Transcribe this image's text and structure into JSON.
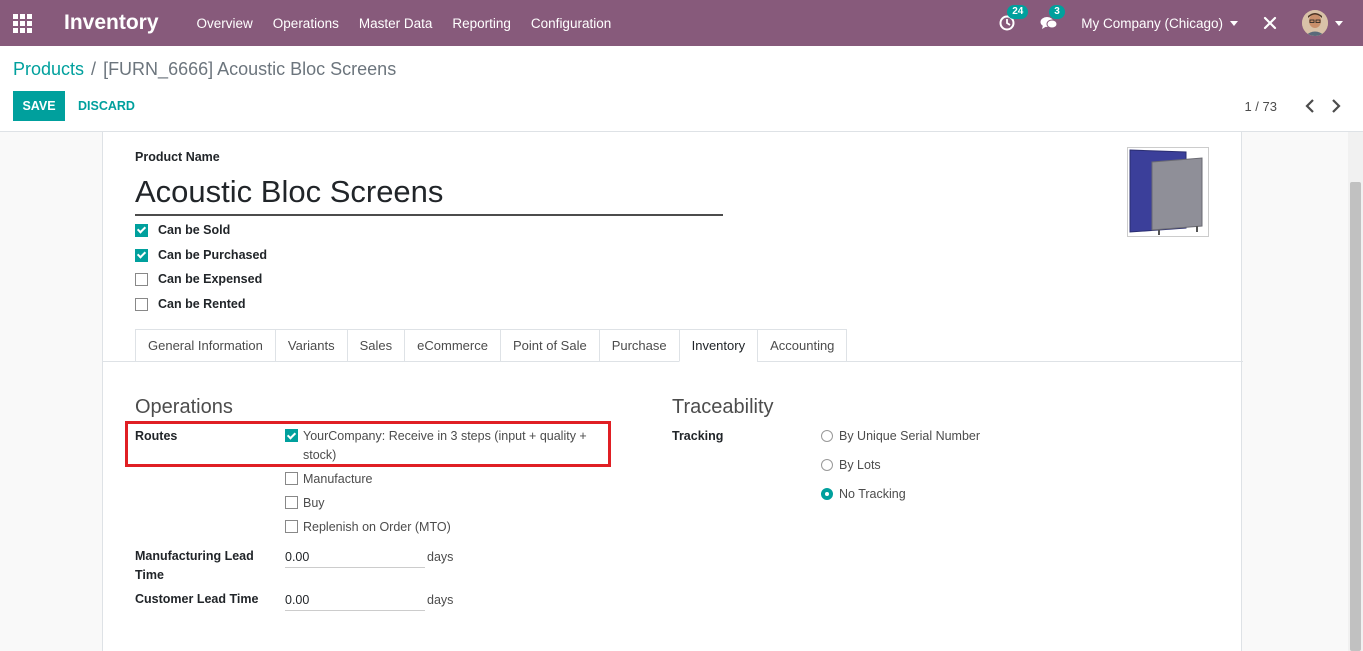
{
  "navbar": {
    "brand": "Inventory",
    "menu": [
      "Overview",
      "Operations",
      "Master Data",
      "Reporting",
      "Configuration"
    ],
    "activity_badge": "24",
    "messages_badge": "3",
    "company": "My Company (Chicago)"
  },
  "control_panel": {
    "breadcrumb_parent": "Products",
    "breadcrumb_current": "[FURN_6666] Acoustic Bloc Screens",
    "save_label": "SAVE",
    "discard_label": "DISCARD",
    "pager": "1 / 73"
  },
  "product": {
    "name_label": "Product Name",
    "name": "Acoustic Bloc Screens",
    "flags": [
      {
        "label": "Can be Sold",
        "checked": true
      },
      {
        "label": "Can be Purchased",
        "checked": true
      },
      {
        "label": "Can be Expensed",
        "checked": false
      },
      {
        "label": "Can be Rented",
        "checked": false
      }
    ]
  },
  "tabs": [
    "General Information",
    "Variants",
    "Sales",
    "eCommerce",
    "Point of Sale",
    "Purchase",
    "Inventory",
    "Accounting"
  ],
  "active_tab": "Inventory",
  "operations": {
    "title": "Operations",
    "routes_label": "Routes",
    "routes": [
      {
        "label_line1": "YourCompany: Receive in 3 steps (input + quality +",
        "label_line2": "stock)",
        "checked": true
      },
      {
        "label": "Manufacture",
        "checked": false
      },
      {
        "label": "Buy",
        "checked": false
      },
      {
        "label": "Replenish on Order (MTO)",
        "checked": false
      }
    ],
    "mfg_lead_label_line1": "Manufacturing Lead",
    "mfg_lead_label_line2": "Time",
    "mfg_lead_value": "0.00",
    "customer_lead_label": "Customer Lead Time",
    "customer_lead_value": "0.00",
    "unit": "days"
  },
  "traceability": {
    "title": "Traceability",
    "tracking_label": "Tracking",
    "options": [
      {
        "label": "By Unique Serial Number",
        "checked": false
      },
      {
        "label": "By Lots",
        "checked": false
      },
      {
        "label": "No Tracking",
        "checked": true
      }
    ]
  },
  "colors": {
    "navbar": "#875a7b",
    "primary": "#00a09d",
    "highlight": "#e01f24"
  }
}
